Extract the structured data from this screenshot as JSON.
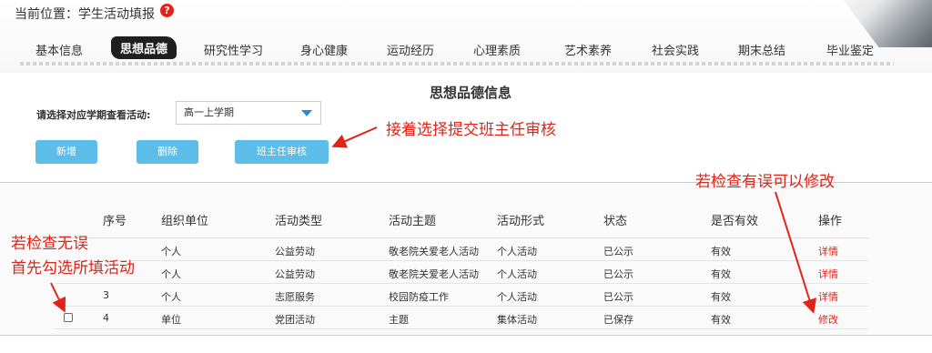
{
  "breadcrumb": {
    "text": "当前位置：学生活动填报",
    "help_icon": "?"
  },
  "tabs": [
    {
      "label": "基本信息"
    },
    {
      "label": "思想品德"
    },
    {
      "label": "研究性学习"
    },
    {
      "label": "身心健康"
    },
    {
      "label": "运动经历"
    },
    {
      "label": "心理素质"
    },
    {
      "label": "艺术素养"
    },
    {
      "label": "社会实践"
    },
    {
      "label": "期末总结"
    },
    {
      "label": "毕业鉴定"
    }
  ],
  "active_tab": "思想品德",
  "section_title": "思想品德信息",
  "term": {
    "label": "请选择对应学期查看活动:",
    "selected": "高一上学期"
  },
  "buttons": {
    "add": "新增",
    "delete": "删除",
    "review": "班主任审核"
  },
  "annotations": {
    "submit": "接着选择提交班主任审核",
    "edit": "若检查有误可以修改",
    "check_line1": "若检查无误",
    "check_line2": "首先勾选所填活动"
  },
  "table": {
    "headers": [
      "序号",
      "组织单位",
      "活动类型",
      "活动主题",
      "活动形式",
      "状态",
      "是否有效",
      "操作"
    ],
    "rows": [
      {
        "no": "",
        "org": "个人",
        "type": "公益劳动",
        "topic": "敬老院关爱老人活动",
        "form": "个人活动",
        "status": "已公示",
        "valid": "有效",
        "action": "详情"
      },
      {
        "no": "",
        "org": "个人",
        "type": "公益劳动",
        "topic": "敬老院关爱老人活动",
        "form": "个人活动",
        "status": "已公示",
        "valid": "有效",
        "action": "详情"
      },
      {
        "no": "3",
        "org": "个人",
        "type": "志愿服务",
        "topic": "校园防疫工作",
        "form": "个人活动",
        "status": "已公示",
        "valid": "有效",
        "action": "详情"
      },
      {
        "no": "4",
        "org": "单位",
        "type": "党团活动",
        "topic": "主题",
        "form": "集体活动",
        "status": "已保存",
        "valid": "有效",
        "action": "修改"
      }
    ]
  },
  "colors": {
    "accent_button": "#5cbde8",
    "annotation_red": "#e1241a",
    "caret_blue": "#2a8ad8"
  }
}
